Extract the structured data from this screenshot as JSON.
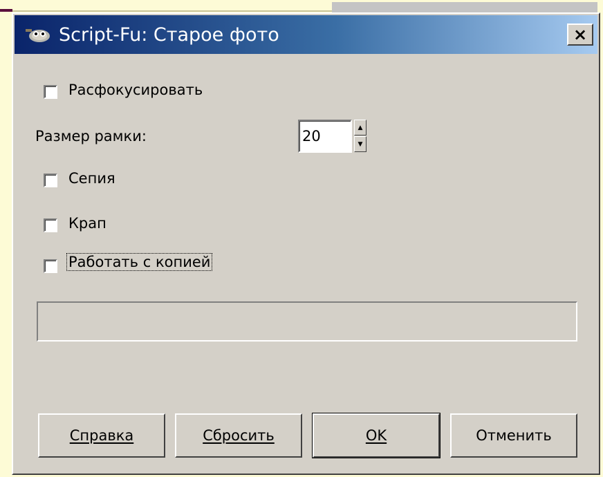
{
  "window": {
    "title": "Script-Fu: Старое фото",
    "close_glyph": "×",
    "icon": "gimp-wilber-icon"
  },
  "form": {
    "blur_label": "Расфокусировать",
    "blur_checked": false,
    "border_size_label": "Размер рамки:",
    "border_size_value": "20",
    "sepia_label": "Сепия",
    "sepia_checked": false,
    "mottle_label": "Крап",
    "mottle_checked": false,
    "work_on_copy_label": "Работать с копией",
    "work_on_copy_checked": false
  },
  "progress": {
    "value": 0
  },
  "buttons": {
    "help": "Справка",
    "reset": "Сбросить",
    "ok": "OK",
    "cancel": "Отменить"
  },
  "colors": {
    "titlebar_start": "#0a246a",
    "titlebar_end": "#a6caf0",
    "dialog_bg": "#d4d0c8",
    "page_bg": "#fdfbd6",
    "accent": "#5a0f3c"
  }
}
